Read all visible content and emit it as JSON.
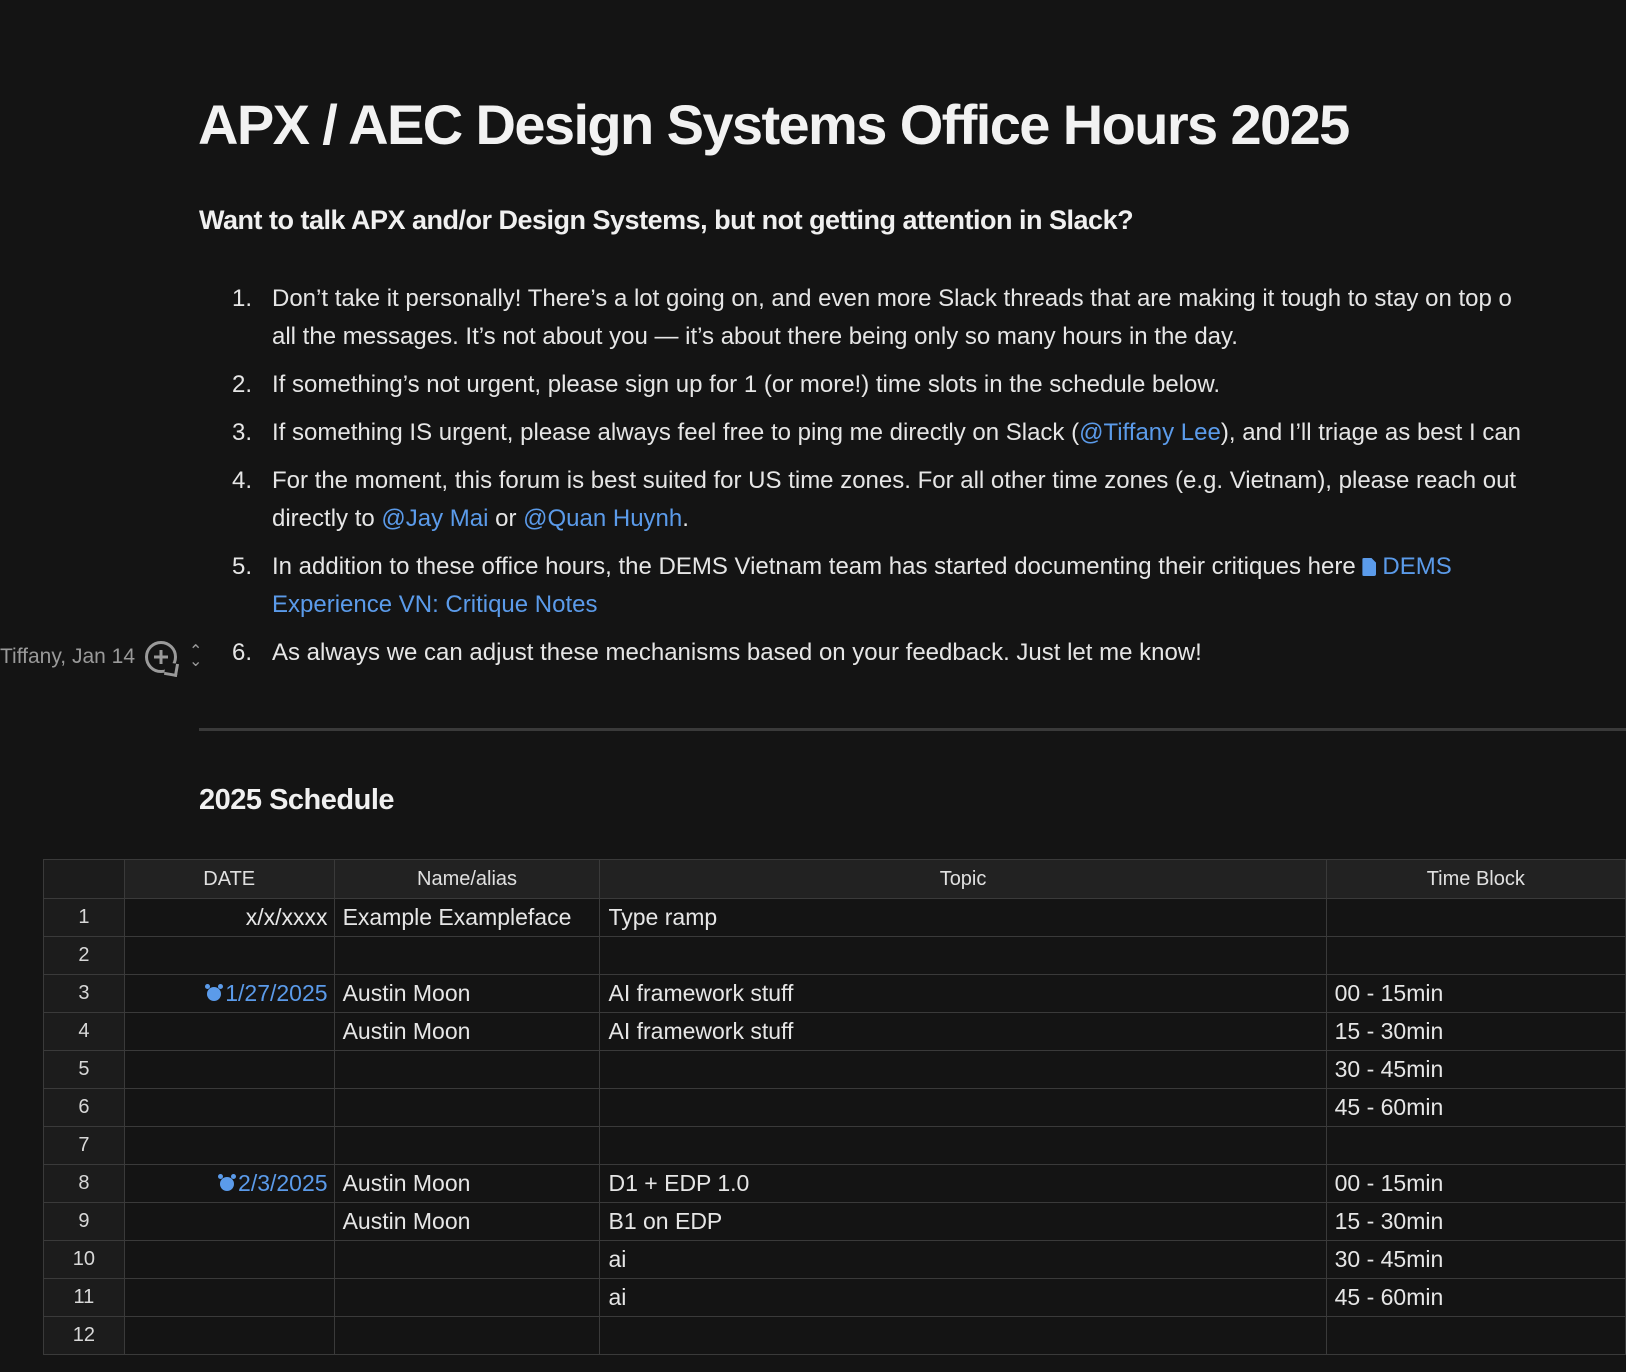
{
  "page": {
    "title": "APX / AEC Design Systems Office Hours 2025",
    "subtitle": "Want to talk APX and/or Design Systems, but not getting attention in Slack?"
  },
  "list": {
    "items": [
      {
        "num": "1.",
        "line1": "Don’t take it personally! There’s a lot going on, and even more Slack threads that are making it tough to stay on top o",
        "line2": "all the messages. It’s not about you — it’s about there being only so many hours in the day."
      },
      {
        "num": "2.",
        "line1": "If something’s not urgent, please sign up for 1 (or more!) time slots in the schedule below."
      },
      {
        "num": "3.",
        "pre": "If something IS urgent, please always feel free to ping me directly on Slack (",
        "mention": "@Tiffany Lee",
        "post": "), and I’ll triage as best I can"
      },
      {
        "num": "4.",
        "line1": "For the moment, this forum is best suited for US time zones. For all other time zones (e.g. Vietnam), please reach out",
        "pre2": "directly to ",
        "mention1": "@Jay Mai",
        "mid2": " or ",
        "mention2": "@Quan Huynh",
        "post2": "."
      },
      {
        "num": "5.",
        "pre": "In addition to these office hours, the DEMS Vietnam team has started documenting their critiques here ",
        "link_part1": "DEMS",
        "link_part2": "Experience VN: Critique Notes"
      },
      {
        "num": "6.",
        "line1": "As always we can adjust these mechanisms based on your feedback. Just let me know!"
      }
    ]
  },
  "comment": {
    "author": "Tiffany, Jan 14",
    "add_icon": "add-comment-icon",
    "reorder_icon": "reorder-icon"
  },
  "schedule": {
    "title": "2025 Schedule",
    "columns": [
      "DATE",
      "Name/alias",
      "Topic",
      "Time Block"
    ],
    "rows": [
      {
        "n": "1",
        "date": "x/x/xxxx",
        "date_link": false,
        "name": "Example Exampleface",
        "topic": "Type ramp",
        "time": ""
      },
      {
        "n": "2",
        "date": "",
        "date_link": false,
        "name": "",
        "topic": "",
        "time": ""
      },
      {
        "n": "3",
        "date": "1/27/2025",
        "date_link": true,
        "name": "Austin Moon",
        "topic": "AI framework stuff",
        "time": "00 - 15min"
      },
      {
        "n": "4",
        "date": "",
        "date_link": false,
        "name": "Austin Moon",
        "topic": "AI framework stuff",
        "time": "15 - 30min"
      },
      {
        "n": "5",
        "date": "",
        "date_link": false,
        "name": "",
        "topic": "",
        "time": "30 - 45min"
      },
      {
        "n": "6",
        "date": "",
        "date_link": false,
        "name": "",
        "topic": "",
        "time": "45 - 60min"
      },
      {
        "n": "7",
        "date": "",
        "date_link": false,
        "name": "",
        "topic": "",
        "time": ""
      },
      {
        "n": "8",
        "date": "2/3/2025",
        "date_link": true,
        "name": "Austin Moon",
        "topic": "D1 + EDP 1.0",
        "time": "00 - 15min"
      },
      {
        "n": "9",
        "date": "",
        "date_link": false,
        "name": "Austin Moon",
        "topic": "B1 on EDP",
        "time": "15 - 30min"
      },
      {
        "n": "10",
        "date": "",
        "date_link": false,
        "name": "",
        "topic": "ai",
        "time": "30 - 45min"
      },
      {
        "n": "11",
        "date": "",
        "date_link": false,
        "name": "",
        "topic": "ai",
        "time": "45 - 60min"
      },
      {
        "n": "12",
        "date": "",
        "date_link": false,
        "name": "",
        "topic": "",
        "time": ""
      }
    ]
  },
  "colors": {
    "background": "#141414",
    "text": "#e6e6e6",
    "link": "#5b9bea",
    "grid": "#3a3a3a"
  }
}
